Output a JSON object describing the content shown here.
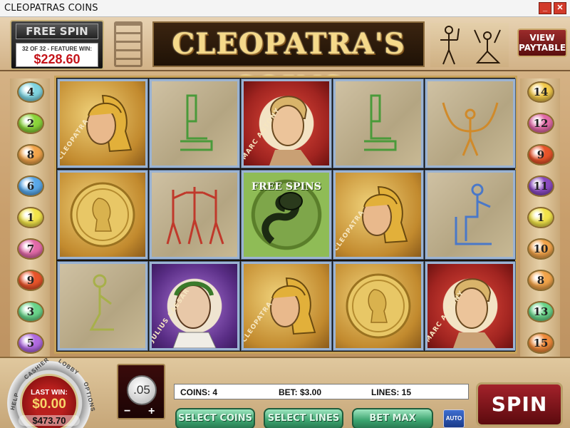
{
  "window": {
    "title": "CLEOPATRAS COINS"
  },
  "header": {
    "free_spin_title": "FREE SPIN",
    "free_spin_progress": "32 OF 32 - FEATURE WIN:",
    "feature_win": "$228.60",
    "logo": "CLEOPATRA'S COINS",
    "paytable_label": "VIEW PAYTABLE"
  },
  "paylines": {
    "left": [
      {
        "label": "4",
        "color": "#7fd4e0"
      },
      {
        "label": "2",
        "color": "#8bd43a"
      },
      {
        "label": "8",
        "color": "#f2a44a"
      },
      {
        "label": "6",
        "color": "#5aa8e8"
      },
      {
        "label": "1",
        "color": "#f2e44a"
      },
      {
        "label": "7",
        "color": "#e26aa8"
      },
      {
        "label": "9",
        "color": "#e8542a"
      },
      {
        "label": "3",
        "color": "#6ad48a"
      },
      {
        "label": "5",
        "color": "#b06ae0"
      }
    ],
    "right": [
      {
        "label": "14",
        "color": "#f2c94a"
      },
      {
        "label": "12",
        "color": "#e26aa8"
      },
      {
        "label": "9",
        "color": "#e8542a"
      },
      {
        "label": "11",
        "color": "#8a4ac0"
      },
      {
        "label": "1",
        "color": "#f2e44a"
      },
      {
        "label": "10",
        "color": "#f2a44a"
      },
      {
        "label": "8",
        "color": "#f2a44a"
      },
      {
        "label": "13",
        "color": "#6ad48a"
      },
      {
        "label": "15",
        "color": "#f08a3a"
      }
    ]
  },
  "reels": [
    [
      {
        "symbol": "cleopatra-portrait",
        "style": "orange",
        "label": "CLEOPATRA"
      },
      {
        "symbol": "gold-coin",
        "style": "orange",
        "label": ""
      },
      {
        "symbol": "kneeling-hieroglyph",
        "style": "beige",
        "label": ""
      }
    ],
    [
      {
        "symbol": "seated-hieroglyph",
        "style": "beige",
        "label": ""
      },
      {
        "symbol": "dancers-hieroglyph",
        "style": "beige",
        "label": ""
      },
      {
        "symbol": "julius-caesar-portrait",
        "style": "purple",
        "label": "JULIUS CAESAR"
      }
    ],
    [
      {
        "symbol": "marc-antony-portrait",
        "style": "red",
        "label": "MARC ANTONY"
      },
      {
        "symbol": "cobra-free-spins",
        "style": "green",
        "label": "FREE SPINS"
      },
      {
        "symbol": "cleopatra-portrait",
        "style": "orange",
        "label": "CLEOPATRA"
      }
    ],
    [
      {
        "symbol": "seated-hieroglyph",
        "style": "beige",
        "label": ""
      },
      {
        "symbol": "cleopatra-portrait",
        "style": "orange",
        "label": "CLEOPATRA"
      },
      {
        "symbol": "gold-coin",
        "style": "orange",
        "label": ""
      }
    ],
    [
      {
        "symbol": "rope-hieroglyph",
        "style": "beige",
        "label": ""
      },
      {
        "symbol": "seated-figure-hieroglyph",
        "style": "beige",
        "label": ""
      },
      {
        "symbol": "marc-antony-portrait",
        "style": "red",
        "label": "MARC ANTONY"
      }
    ]
  ],
  "dial": {
    "cashier": "CASHIER",
    "lobby": "LOBBY",
    "help": "HELP",
    "options": "OPTIONS",
    "last_win_label": "LAST WIN:",
    "last_win": "$0.00",
    "balance": "$473.70"
  },
  "controls": {
    "coin_value": ".05",
    "coin_minus": "−",
    "coin_plus": "+",
    "coins_text": "COINS: 4",
    "bet_text": "BET: $3.00",
    "lines_text": "LINES: 15",
    "select_coins": "SELECT COINS",
    "select_lines": "SELECT LINES",
    "bet_max": "BET MAX",
    "auto": "AUTO",
    "spin": "SPIN"
  },
  "colors": {
    "accent_red": "#c4141a",
    "button_green": "#3aa36e",
    "gold": "#f5d98a"
  }
}
